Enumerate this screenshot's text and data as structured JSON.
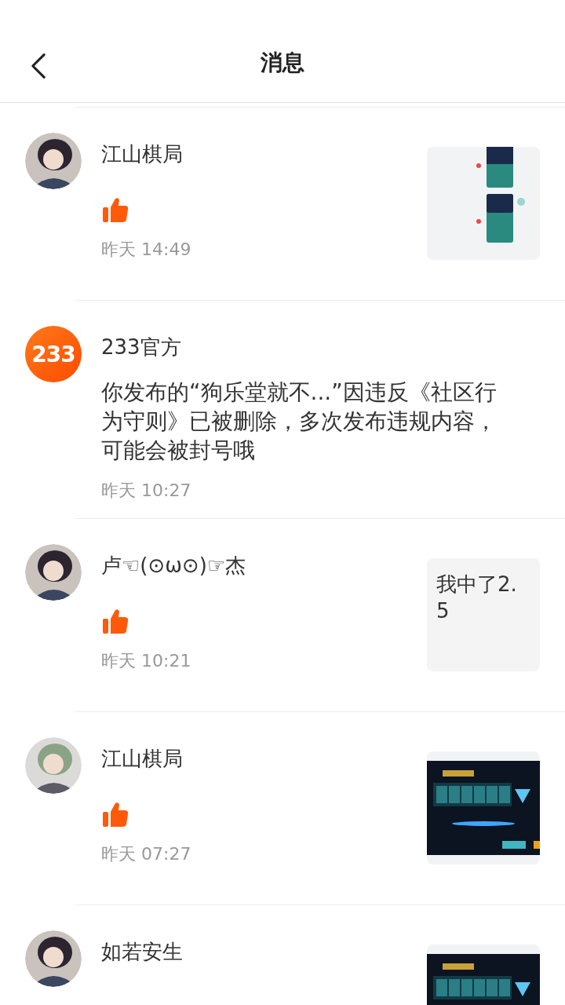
{
  "header": {
    "title": "消息"
  },
  "messages": [
    {
      "name": "江山棋局",
      "content": {
        "kind": "like"
      },
      "time": "昨天 14:49"
    },
    {
      "avatar": {
        "kind": "logo",
        "text": "233"
      },
      "name": "233官方",
      "content": {
        "kind": "text",
        "text": "你发布的“狗乐堂就不...”因违反《社区行为守则》已被删除，多次发布违规内容，可能会被封号哦"
      },
      "time": "昨天 10:27"
    },
    {
      "name": "卢☜(⊙ω⊙)☞杰",
      "content": {
        "kind": "like"
      },
      "time": "昨天 10:21",
      "preview": {
        "kind": "text",
        "text": "我中了2.5"
      }
    },
    {
      "name": "江山棋局",
      "content": {
        "kind": "like"
      },
      "time": "昨天 07:27"
    },
    {
      "name": "如若安生"
    }
  ]
}
